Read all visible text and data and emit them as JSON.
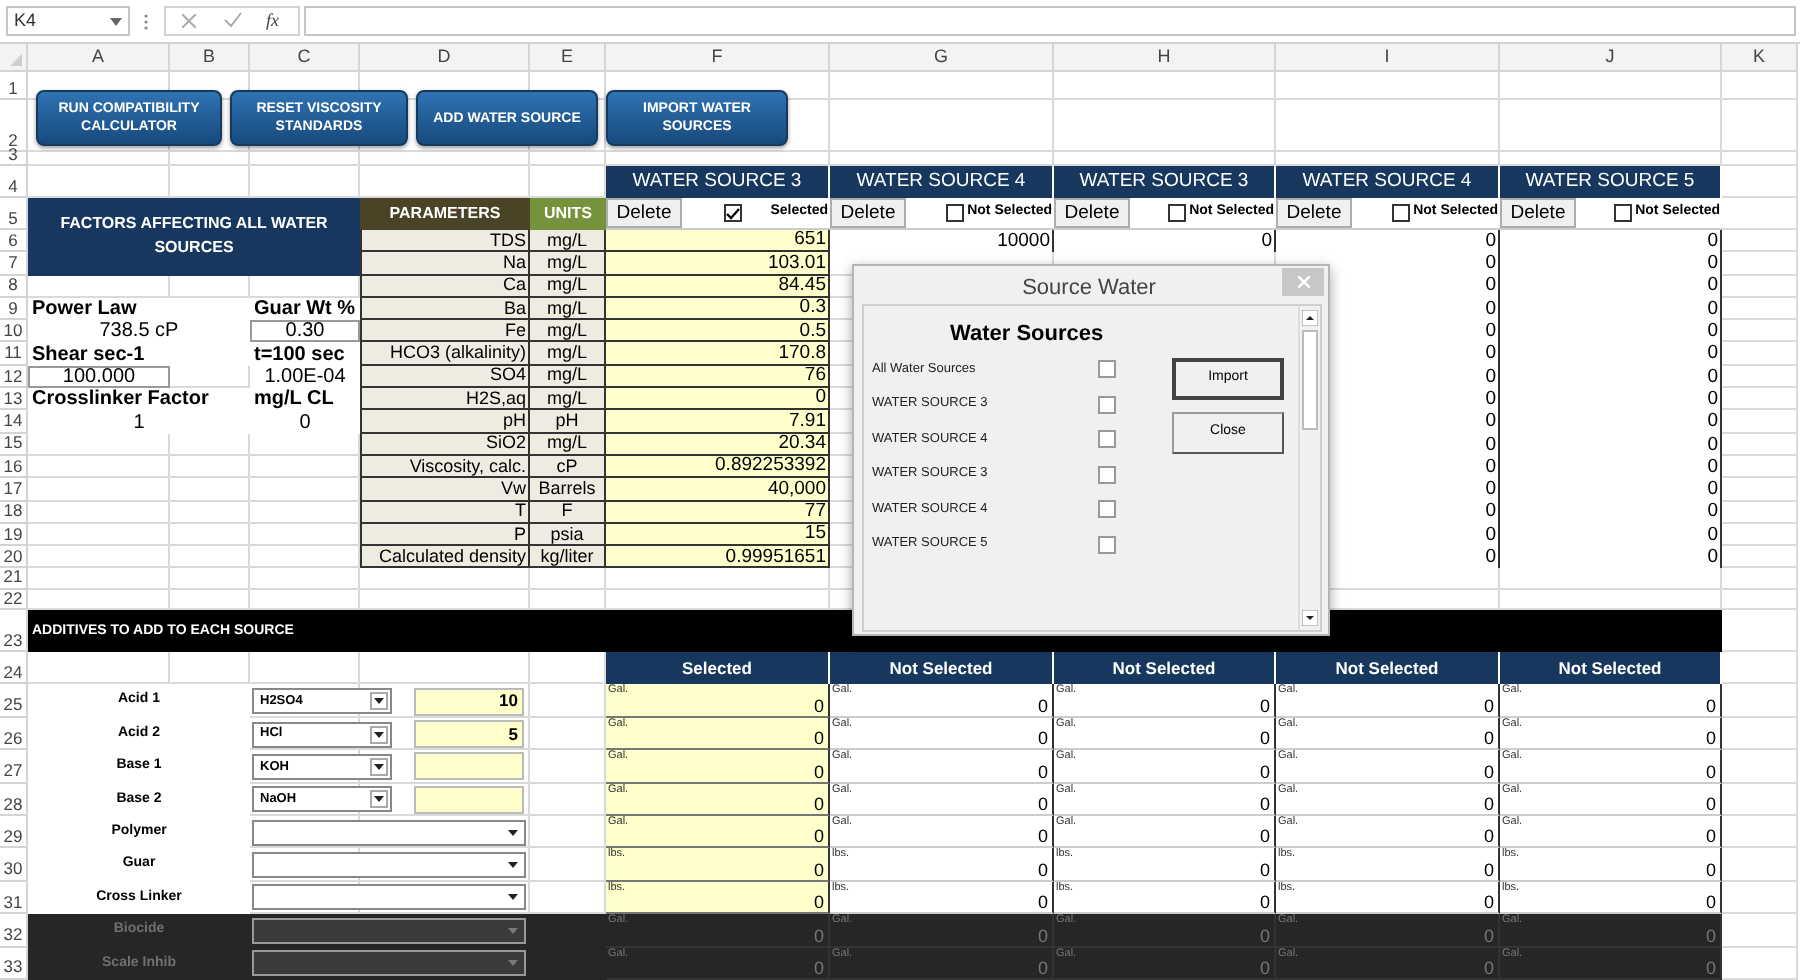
{
  "formula_bar": {
    "name_box": "K4",
    "function_label": "fx"
  },
  "columns": [
    "A",
    "B",
    "C",
    "D",
    "E",
    "F",
    "G",
    "H",
    "I",
    "J",
    "K"
  ],
  "rows": [
    "1",
    "2",
    "3",
    "4",
    "5",
    "6",
    "7",
    "8",
    "9",
    "10",
    "11",
    "12",
    "13",
    "14",
    "15",
    "16",
    "17",
    "18",
    "19",
    "20",
    "21",
    "22",
    "23",
    "24",
    "25",
    "26",
    "27",
    "28",
    "29",
    "30",
    "31",
    "32",
    "33"
  ],
  "buttons": [
    "RUN COMPATIBILITY CALCULATOR",
    "RESET VISCOSITY STANDARDS",
    "ADD WATER SOURCE",
    "IMPORT WATER SOURCES"
  ],
  "factors": {
    "title": "FACTORS AFFECTING ALL WATER SOURCES",
    "rows": [
      {
        "kind": "label",
        "a": "Power Law",
        "c": "Guar Wt %",
        "a_input": false,
        "c_input": false
      },
      {
        "kind": "value",
        "a": "738.5 cP",
        "c": "0.30",
        "a_input": false,
        "c_input": true
      },
      {
        "kind": "label",
        "a": "Shear sec-1",
        "c": "t=100 sec",
        "a_input": false,
        "c_input": false
      },
      {
        "kind": "value",
        "a": "100.000",
        "c": "1.00E-04",
        "a_input": true,
        "c_input": false
      },
      {
        "kind": "label",
        "a": "Crosslinker Factor",
        "c": "mg/L CL",
        "a_input": false,
        "c_input": false
      },
      {
        "kind": "value",
        "a": "1",
        "c": "0",
        "a_input": false,
        "c_input": false
      }
    ]
  },
  "parameters": {
    "header": "PARAMETERS",
    "units_header": "UNITS",
    "rows": [
      {
        "name": "TDS",
        "unit": "mg/L"
      },
      {
        "name": "Na",
        "unit": "mg/L"
      },
      {
        "name": "Ca",
        "unit": "mg/L"
      },
      {
        "name": "Ba",
        "unit": "mg/L"
      },
      {
        "name": "Fe",
        "unit": "mg/L"
      },
      {
        "name": "HCO3 (alkalinity)",
        "unit": "mg/L"
      },
      {
        "name": "SO4",
        "unit": "mg/L"
      },
      {
        "name": "H2S,aq",
        "unit": "mg/L"
      },
      {
        "name": "pH",
        "unit": "pH"
      },
      {
        "name": "SiO2",
        "unit": "mg/L"
      },
      {
        "name": "Viscosity, calc.",
        "unit": "cP"
      },
      {
        "name": "Vw",
        "unit": "Barrels"
      },
      {
        "name": "T",
        "unit": "F"
      },
      {
        "name": "P",
        "unit": "psia"
      },
      {
        "name": "Calculated density",
        "unit": "kg/liter"
      }
    ]
  },
  "sources": [
    {
      "title": "WATER SOURCE 3",
      "delete_label": "Delete",
      "selected": true,
      "status": "Selected",
      "values": [
        "651",
        "103.01",
        "84.45",
        "0.3",
        "0.5",
        "170.8",
        "76",
        "0",
        "7.91",
        "20.34",
        "0.892253392",
        "40,000",
        "77",
        "15",
        "0.99951651"
      ],
      "additive_header": "Selected",
      "additives": [
        {
          "unit": "Gal.",
          "value": "0"
        },
        {
          "unit": "Gal.",
          "value": "0"
        },
        {
          "unit": "Gal.",
          "value": "0"
        },
        {
          "unit": "Gal.",
          "value": "0"
        },
        {
          "unit": "Gal.",
          "value": "0"
        },
        {
          "unit": "lbs.",
          "value": "0"
        },
        {
          "unit": "lbs.",
          "value": "0"
        },
        {
          "unit": "Gal.",
          "value": "0"
        },
        {
          "unit": "Gal.",
          "value": "0"
        }
      ]
    },
    {
      "title": "WATER SOURCE 4",
      "delete_label": "Delete",
      "selected": false,
      "status": "Not Selected",
      "values": [
        "10000"
      ],
      "additive_header": "Not Selected",
      "additives": [
        {
          "unit": "Gal.",
          "value": "0"
        },
        {
          "unit": "Gal.",
          "value": "0"
        },
        {
          "unit": "Gal.",
          "value": "0"
        },
        {
          "unit": "Gal.",
          "value": "0"
        },
        {
          "unit": "Gal.",
          "value": "0"
        },
        {
          "unit": "lbs.",
          "value": "0"
        },
        {
          "unit": "lbs.",
          "value": "0"
        },
        {
          "unit": "Gal.",
          "value": "0"
        },
        {
          "unit": "Gal.",
          "value": "0"
        }
      ]
    },
    {
      "title": "WATER SOURCE 3",
      "delete_label": "Delete",
      "selected": false,
      "status": "Not Selected",
      "values": [
        "0"
      ],
      "additive_header": "Not Selected",
      "additives": [
        {
          "unit": "Gal.",
          "value": "0"
        },
        {
          "unit": "Gal.",
          "value": "0"
        },
        {
          "unit": "Gal.",
          "value": "0"
        },
        {
          "unit": "Gal.",
          "value": "0"
        },
        {
          "unit": "Gal.",
          "value": "0"
        },
        {
          "unit": "lbs.",
          "value": "0"
        },
        {
          "unit": "lbs.",
          "value": "0"
        },
        {
          "unit": "Gal.",
          "value": "0"
        },
        {
          "unit": "Gal.",
          "value": "0"
        }
      ]
    },
    {
      "title": "WATER SOURCE 4",
      "delete_label": "Delete",
      "selected": false,
      "status": "Not Selected",
      "values": [
        "0",
        "0",
        "0",
        "0",
        "0",
        "0",
        "0",
        "0",
        "0",
        "0",
        "0",
        "0",
        "0",
        "0",
        "0"
      ],
      "additive_header": "Not Selected",
      "additives": [
        {
          "unit": "Gal.",
          "value": "0"
        },
        {
          "unit": "Gal.",
          "value": "0"
        },
        {
          "unit": "Gal.",
          "value": "0"
        },
        {
          "unit": "Gal.",
          "value": "0"
        },
        {
          "unit": "Gal.",
          "value": "0"
        },
        {
          "unit": "lbs.",
          "value": "0"
        },
        {
          "unit": "lbs.",
          "value": "0"
        },
        {
          "unit": "Gal.",
          "value": "0"
        },
        {
          "unit": "Gal.",
          "value": "0"
        }
      ]
    },
    {
      "title": "WATER SOURCE 5",
      "delete_label": "Delete",
      "selected": false,
      "status": "Not Selected",
      "values": [
        "0",
        "0",
        "0",
        "0",
        "0",
        "0",
        "0",
        "0",
        "0",
        "0",
        "0",
        "0",
        "0",
        "0",
        "0"
      ],
      "additive_header": "Not Selected",
      "additives": [
        {
          "unit": "Gal.",
          "value": "0"
        },
        {
          "unit": "Gal.",
          "value": "0"
        },
        {
          "unit": "Gal.",
          "value": "0"
        },
        {
          "unit": "Gal.",
          "value": "0"
        },
        {
          "unit": "Gal.",
          "value": "0"
        },
        {
          "unit": "lbs.",
          "value": "0"
        },
        {
          "unit": "lbs.",
          "value": "0"
        },
        {
          "unit": "Gal.",
          "value": "0"
        },
        {
          "unit": "Gal.",
          "value": "0"
        }
      ]
    }
  ],
  "additives": {
    "title": "ADDITIVES TO ADD TO EACH SOURCE",
    "rows": [
      {
        "label": "Acid 1",
        "kind": "short",
        "chemical": "H2SO4",
        "amount": "10",
        "disabled": false
      },
      {
        "label": "Acid 2",
        "kind": "short",
        "chemical": "HCl",
        "amount": "5",
        "disabled": false
      },
      {
        "label": "Base 1",
        "kind": "short",
        "chemical": "KOH",
        "disabled": false
      },
      {
        "label": "Base 2",
        "kind": "short",
        "chemical": "NaOH",
        "disabled": false
      },
      {
        "label": "Polymer",
        "kind": "long",
        "disabled": false
      },
      {
        "label": "Guar",
        "kind": "long",
        "disabled": false
      },
      {
        "label": "Cross Linker",
        "kind": "long",
        "disabled": false
      },
      {
        "label": "Biocide",
        "kind": "long",
        "disabled": true
      },
      {
        "label": "Scale Inhib",
        "kind": "long",
        "disabled": true
      }
    ]
  },
  "dialog": {
    "title": "Source Water",
    "heading": "Water Sources",
    "items": [
      {
        "label": "All Water Sources",
        "checked": false
      },
      {
        "label": "WATER SOURCE 3",
        "checked": false
      },
      {
        "label": "WATER SOURCE 4",
        "checked": false
      },
      {
        "label": "WATER SOURCE 3",
        "checked": false
      },
      {
        "label": "WATER SOURCE 4",
        "checked": false
      },
      {
        "label": "WATER SOURCE 5",
        "checked": false
      }
    ],
    "buttons": [
      "Import",
      "Close"
    ]
  }
}
